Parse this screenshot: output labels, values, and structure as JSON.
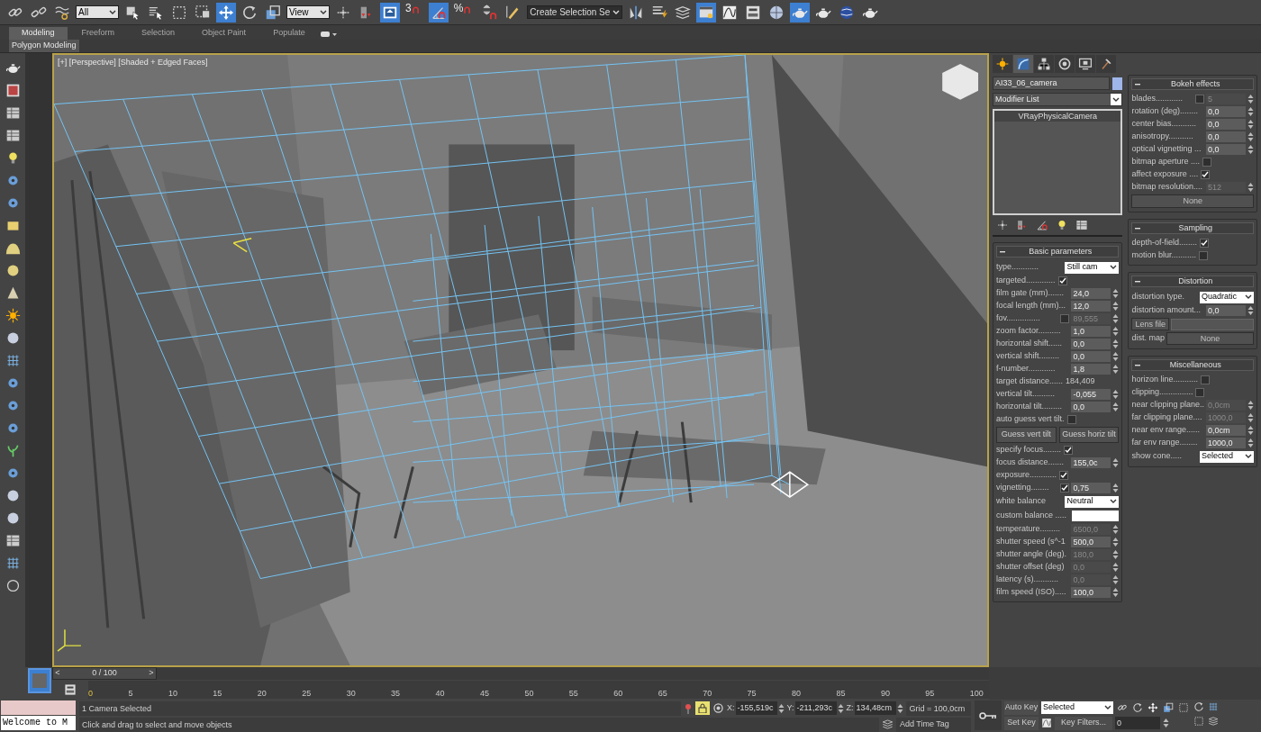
{
  "main_toolbar": [
    {
      "kind": "link",
      "selected": false
    },
    {
      "kind": "unlink",
      "selected": false
    },
    {
      "kind": "bind",
      "selected": false
    },
    {
      "kind": "dropdown",
      "value": "All"
    },
    {
      "kind": "select",
      "selected": false
    },
    {
      "kind": "selectlist",
      "selected": false
    },
    {
      "kind": "region",
      "selected": false
    },
    {
      "kind": "crossing",
      "selected": false
    },
    {
      "kind": "move",
      "selected": true
    },
    {
      "kind": "rotate",
      "selected": false
    },
    {
      "kind": "scale",
      "selected": false
    },
    {
      "kind": "dropdown",
      "value": "View"
    },
    {
      "kind": "pivot",
      "selected": false
    },
    {
      "kind": "manipulate",
      "selected": false
    },
    {
      "kind": "keyboard",
      "selected": true
    },
    {
      "kind": "snap",
      "label": "3",
      "selected": false
    },
    {
      "kind": "angle",
      "selected": true
    },
    {
      "kind": "snap",
      "label": "%",
      "selected": false
    },
    {
      "kind": "spinsnap",
      "selected": false
    },
    {
      "kind": "pencil",
      "selected": false
    },
    {
      "kind": "dropdown",
      "value": "Create Selection Se"
    },
    {
      "kind": "mirror",
      "selected": false
    },
    {
      "kind": "align",
      "selected": false
    },
    {
      "kind": "layers",
      "selected": false
    },
    {
      "kind": "explorer",
      "selected": true
    },
    {
      "kind": "curve",
      "selected": false
    },
    {
      "kind": "schematic",
      "selected": false
    },
    {
      "kind": "material",
      "selected": false
    },
    {
      "kind": "teapot",
      "selected": true
    },
    {
      "kind": "teapot",
      "selected": false
    },
    {
      "kind": "globe",
      "selected": false
    },
    {
      "kind": "teapot",
      "selected": false
    }
  ],
  "ribbon": {
    "tabs": [
      {
        "label": "Modeling",
        "selected": true
      },
      {
        "label": "Freeform",
        "selected": false
      },
      {
        "label": "Selection",
        "selected": false
      },
      {
        "label": "Object Paint",
        "selected": false
      },
      {
        "label": "Populate",
        "selected": false
      }
    ],
    "panel": "Polygon Modeling"
  },
  "viewport": {
    "label": "[+] [Perspective] [Shaded + Edged Faces]"
  },
  "command_panel": {
    "tabs": [
      {
        "kind": "create",
        "selected": false
      },
      {
        "kind": "modify",
        "selected": true
      },
      {
        "kind": "hierarchy",
        "selected": false
      },
      {
        "kind": "motion",
        "selected": false
      },
      {
        "kind": "display",
        "selected": false
      },
      {
        "kind": "utilities",
        "selected": false
      }
    ],
    "object_name": "AI33_06_camera",
    "modifier_list": "Modifier List",
    "stack": [
      "VRayPhysicalCamera"
    ]
  },
  "rollouts_left": [
    {
      "title": "Basic parameters",
      "rows": [
        {
          "kind": "dropdown",
          "label": "type............",
          "value": "Still cam"
        },
        {
          "kind": "check",
          "label": "targeted.............",
          "checked": true
        },
        {
          "kind": "spinner",
          "label": "film gate (mm).......",
          "value": "24,0",
          "disabled": false
        },
        {
          "kind": "spinner",
          "label": "focal length (mm)...",
          "value": "12,0",
          "disabled": false
        },
        {
          "kind": "spinner",
          "label": "fov...............",
          "checked": false,
          "value": "89,555",
          "disabled": true
        },
        {
          "kind": "spinner",
          "label": "zoom factor..........",
          "value": "1,0",
          "disabled": false
        },
        {
          "kind": "spinner",
          "label": "horizontal shift......",
          "value": "0,0",
          "disabled": false
        },
        {
          "kind": "spinner",
          "label": "vertical shift.........",
          "value": "0,0",
          "disabled": false
        },
        {
          "kind": "spinner",
          "label": "f-number............",
          "value": "1,8",
          "disabled": false
        },
        {
          "kind": "readout",
          "label": "target distance......",
          "value": "184,409"
        },
        {
          "kind": "spinner",
          "label": "vertical tilt..........",
          "value": "-0,055",
          "disabled": false
        },
        {
          "kind": "spinner",
          "label": "horizontal tilt.........",
          "value": "0,0",
          "disabled": false
        },
        {
          "kind": "check",
          "label": "auto guess vert tilt.",
          "checked": false
        },
        {
          "kind": "buttons",
          "buttons": [
            "Guess vert tilt",
            "Guess horiz tilt"
          ]
        },
        {
          "kind": "check",
          "label": "specify focus........",
          "checked": true
        },
        {
          "kind": "spinner",
          "label": "focus distance.......",
          "value": "155,0c",
          "disabled": false
        },
        {
          "kind": "check",
          "label": "exposure............",
          "checked": true
        },
        {
          "kind": "spinner",
          "label": "vignetting........",
          "checked": true,
          "value": "0,75",
          "disabled": false
        },
        {
          "kind": "dropdown",
          "label": "white balance",
          "value": "Neutral"
        },
        {
          "kind": "color",
          "label": "custom balance ....."
        },
        {
          "kind": "spinner",
          "label": "temperature.........",
          "value": "6500,0",
          "disabled": true
        },
        {
          "kind": "spinner",
          "label": "shutter speed (s^-1",
          "value": "500,0",
          "disabled": false
        },
        {
          "kind": "spinner",
          "label": "shutter angle (deg).",
          "value": "180,0",
          "disabled": true
        },
        {
          "kind": "spinner",
          "label": "shutter offset (deg)",
          "value": "0,0",
          "disabled": true
        },
        {
          "kind": "spinner",
          "label": "latency (s)...........",
          "value": "0,0",
          "disabled": true
        },
        {
          "kind": "spinner",
          "label": "film speed (ISO).....",
          "value": "100,0",
          "disabled": false
        }
      ]
    }
  ],
  "rollouts_right": [
    {
      "title": "Bokeh effects",
      "rows": [
        {
          "kind": "spinner",
          "label": "blades............",
          "checked": false,
          "value": "5",
          "disabled": true
        },
        {
          "kind": "spinner",
          "label": "rotation (deg)........",
          "value": "0,0",
          "disabled": false
        },
        {
          "kind": "spinner",
          "label": "center bias...........",
          "value": "0,0",
          "disabled": false
        },
        {
          "kind": "spinner",
          "label": "anisotropy...........",
          "value": "0,0",
          "disabled": false
        },
        {
          "kind": "spinner",
          "label": "optical vignetting ...",
          "value": "0,0",
          "disabled": false
        },
        {
          "kind": "check",
          "label": "bitmap aperture ....",
          "checked": false
        },
        {
          "kind": "check",
          "label": "affect exposure ....",
          "checked": true
        },
        {
          "kind": "spinner",
          "label": "bitmap resolution....",
          "value": "512",
          "disabled": true
        },
        {
          "kind": "button",
          "label": "None"
        }
      ]
    },
    {
      "title": "Sampling",
      "rows": [
        {
          "kind": "check",
          "label": "depth-of-field........",
          "checked": true
        },
        {
          "kind": "check",
          "label": "motion blur...........",
          "checked": false
        }
      ]
    },
    {
      "title": "Distortion",
      "rows": [
        {
          "kind": "dropdown",
          "label": "distortion type.",
          "value": "Quadratic"
        },
        {
          "kind": "spinner",
          "label": "distortion amount...",
          "value": "0,0",
          "disabled": false
        },
        {
          "kind": "file",
          "label": "Lens file"
        },
        {
          "kind": "map",
          "label": "dist. map",
          "value": "None"
        }
      ]
    },
    {
      "title": "Miscellaneous",
      "rows": [
        {
          "kind": "check",
          "label": "horizon line...........",
          "checked": false
        },
        {
          "kind": "check",
          "label": "clipping...............",
          "checked": false
        },
        {
          "kind": "spinner",
          "label": "near clipping plane..",
          "value": "0,0cm",
          "disabled": true
        },
        {
          "kind": "spinner",
          "label": "far clipping plane....",
          "value": "1000,0",
          "disabled": true
        },
        {
          "kind": "spinner",
          "label": "near env range......",
          "value": "0,0cm",
          "disabled": false
        },
        {
          "kind": "spinner",
          "label": "far env range........",
          "value": "1000,0",
          "disabled": false
        },
        {
          "kind": "dropdown",
          "label": "show cone.....",
          "value": "Selected"
        }
      ]
    }
  ],
  "timeline": {
    "prev": "<",
    "slider": "0 / 100",
    "next": ">",
    "level": 0,
    "ticks": [
      "0",
      "5",
      "10",
      "15",
      "20",
      "25",
      "30",
      "35",
      "40",
      "45",
      "50",
      "55",
      "60",
      "65",
      "70",
      "75",
      "80",
      "85",
      "90",
      "95",
      "100"
    ]
  },
  "status": {
    "listener": "Welcome to M",
    "selection": "1 Camera Selected",
    "prompt": "Click and drag to select and move objects",
    "lock_selected": true,
    "x_label": "X:",
    "x": "-155,519c",
    "y_label": "Y:",
    "y": "-211,293c",
    "z_label": "Z:",
    "z": "134,48cm",
    "grid": "Grid = 100,0cm",
    "add_time_tag": "Add Time Tag",
    "auto_key": "Auto Key",
    "set_key": "Set Key",
    "key_mode": "Selected",
    "key_filters": "Key Filters...",
    "frame": "0"
  }
}
